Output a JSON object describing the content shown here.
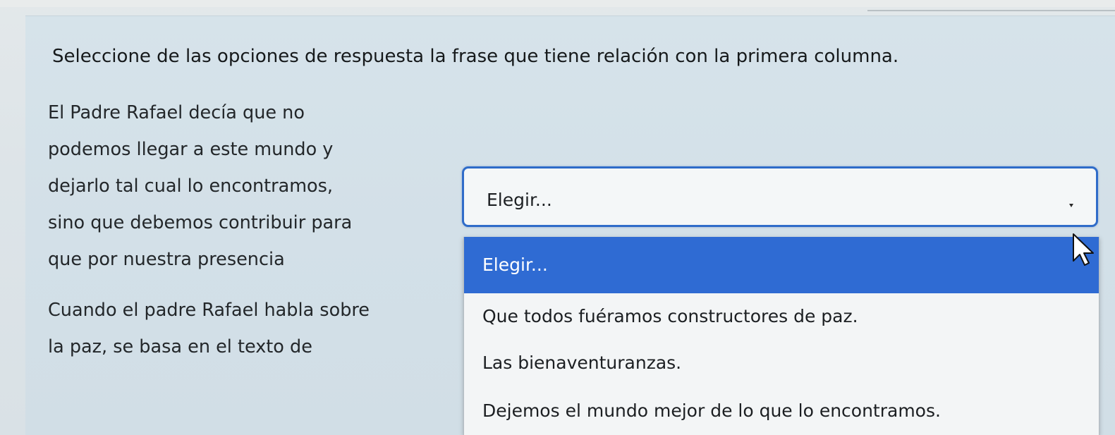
{
  "instruction": "Seleccione de las opciones de respuesta la frase que tiene relación con la primera columna.",
  "questions": [
    {
      "text": "El Padre Rafael decía que no\npodemos llegar a este mundo y\ndejarlo tal cual lo encontramos,\nsino que debemos contribuir para\nque por nuestra presencia"
    },
    {
      "text": "Cuando el padre Rafael habla sobre\nla paz, se basa en el texto de"
    }
  ],
  "select": {
    "value": "Elegir..."
  },
  "dropdown": {
    "options": [
      "Elegir...",
      "Que todos fuéramos constructores de paz.",
      "Las bienaventuranzas.",
      "Dejemos el mundo mejor de lo que lo encontramos."
    ],
    "highlighted": "Elegir..."
  },
  "colors": {
    "highlight": "#2f6bd3",
    "focus_border": "#2f6cc9"
  },
  "icons": {
    "select_arrow": "chevron-down-icon",
    "cursor": "mouse-pointer-icon"
  }
}
